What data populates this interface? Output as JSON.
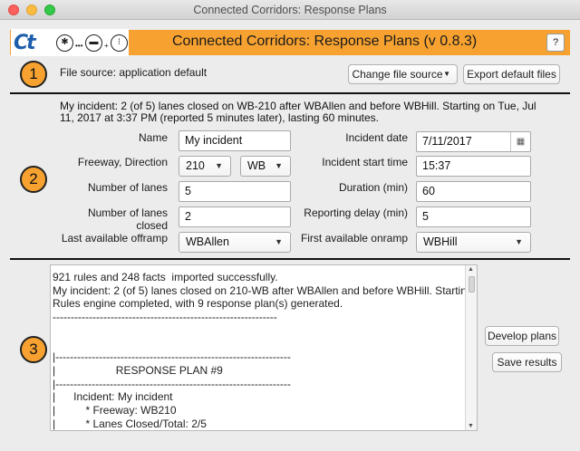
{
  "window": {
    "title": "Connected Corridors: Response Plans"
  },
  "header": {
    "logo_text": "Ct",
    "icons": [
      "accident-icon",
      "vehicles-icon",
      "traffic-signal-icon"
    ],
    "title": "Connected Corridors: Response Plans (v 0.8.3)",
    "help_label": "?"
  },
  "section1": {
    "badge": "1",
    "file_source": "File source: application default",
    "change_source_label": "Change file source",
    "export_label": "Export default files"
  },
  "section2": {
    "badge": "2",
    "summary": "My incident: 2 (of 5) lanes closed on WB-210 after WBAllen and before WBHill. Starting on Tue, Jul 11, 2017 at 3:37 PM (reported 5 minutes later), lasting 60 minutes.",
    "name_label": "Name",
    "name_value": "My incident",
    "freeway_label": "Freeway, Direction",
    "freeway_value": "210",
    "direction_value": "WB",
    "lanes_label": "Number of lanes",
    "lanes_value": "5",
    "lanes_closed_label": "Number of lanes closed",
    "lanes_closed_value": "2",
    "offramp_label": "Last available offramp",
    "offramp_value": "WBAllen",
    "date_label": "Incident date",
    "date_value": "7/11/2017",
    "start_label": "Incident start time",
    "start_value": "15:37",
    "duration_label": "Duration (min)",
    "duration_value": "60",
    "delay_label": "Reporting delay (min)",
    "delay_value": "5",
    "onramp_label": "First available onramp",
    "onramp_value": "WBHill"
  },
  "section3": {
    "badge": "3",
    "develop_label": "Develop plans",
    "save_label": "Save results",
    "output_text": "921 rules and 248 facts  imported successfully.\nMy incident: 2 (of 5) lanes closed on 210-WB after WBAllen and before WBHill. Starting on Tue\nRules engine completed, with 9 response plan(s) generated.\n--------------------------------------------------------------\n\n\n|-----------------------------------------------------------------\n|                    RESPONSE PLAN #9\n|-----------------------------------------------------------------\n|      Incident: My incident\n|          * Freeway: WB210\n|          * Lanes Closed/Total: 2/5"
  }
}
